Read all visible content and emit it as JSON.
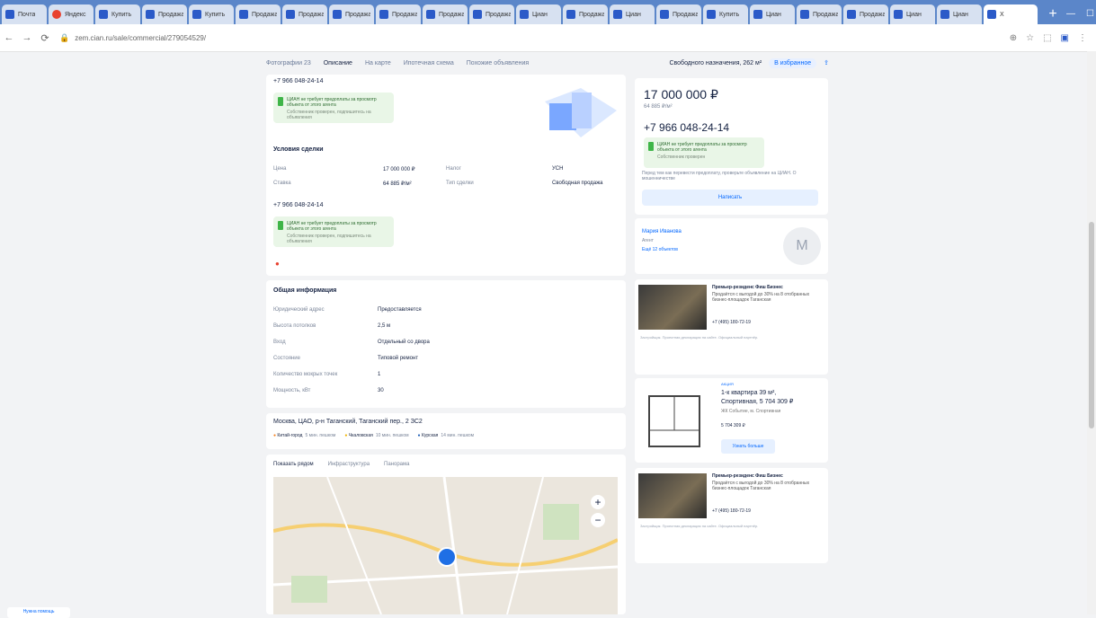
{
  "browser": {
    "tabs": [
      {
        "label": "Почта"
      },
      {
        "label": "Яндекс"
      },
      {
        "label": "Купить"
      },
      {
        "label": "Продажа"
      },
      {
        "label": "Купить"
      },
      {
        "label": "Продажа"
      },
      {
        "label": "Продажа"
      },
      {
        "label": "Продажа"
      },
      {
        "label": "Продажа"
      },
      {
        "label": "Продажа"
      },
      {
        "label": "Продажа"
      },
      {
        "label": "Циан"
      },
      {
        "label": "Продажа"
      },
      {
        "label": "Циан"
      },
      {
        "label": "Продажа"
      },
      {
        "label": "Купить"
      },
      {
        "label": "Циан"
      },
      {
        "label": "Продажа"
      },
      {
        "label": "Продажа"
      },
      {
        "label": "Циан"
      },
      {
        "label": "Циан"
      },
      {
        "label": "Х"
      }
    ],
    "new_tab": "+",
    "url": "zem.cian.ru/sale/commercial/279054529/"
  },
  "anchor_nav": {
    "items": [
      "Фотографии 23",
      "Описание",
      "На карте",
      "Ипотечная схема",
      "Похожие объявления"
    ],
    "right_text": "Свободного назначения, 262 м²",
    "right_btn": "В избранное"
  },
  "left": {
    "phone_top": "+7 966 048-24-14",
    "banner": {
      "title": "ЦИАН не требует предоплаты за просмотр объекта от этого агента",
      "sub": "Собственник проверен, подпишитесь на объявления"
    },
    "deal_title": "Условия сделки",
    "deal": [
      {
        "label": "Цена",
        "value": "17 000 000 ₽"
      },
      {
        "label": "Налог",
        "value": "УСН"
      },
      {
        "label": "Ставка",
        "value": "64 885 ₽/м²"
      },
      {
        "label": "Тип сделки",
        "value": "Свободная продажа"
      }
    ],
    "phone_mid": "+7 966 048-24-14",
    "info_title": "Общая информация",
    "info": [
      {
        "label": "Юридический адрес",
        "value": "Предоставляется"
      },
      {
        "label": "Высота потолков",
        "value": "2,5 м"
      },
      {
        "label": "Вход",
        "value": "Отдельный со двора"
      },
      {
        "label": "Состояние",
        "value": "Типовой ремонт"
      },
      {
        "label": "Количество мокрых точек",
        "value": "1"
      },
      {
        "label": "Мощность, кВт",
        "value": "30"
      }
    ],
    "address": "Москва, ЦАО, р-н Таганский, Таганский пер., 2 ЗС2",
    "metro": [
      {
        "name": "Китай-город",
        "time": "5 мин. пешком",
        "color": "#f58220"
      },
      {
        "name": "Чкаловская",
        "time": "10 мин. пешком",
        "color": "#f0b400"
      },
      {
        "name": "Курская",
        "time": "14 мин. пешком",
        "color": "#1a5bb5"
      }
    ],
    "map_tabs": [
      "Показать рядом",
      "Инфраструктура",
      "Панорама"
    ],
    "map_ctrl": {
      "plus": "+",
      "minus": "−"
    }
  },
  "right": {
    "price": "17 000 000 ₽",
    "price_sub": "64 885 ₽/м²",
    "phone": "+7 966 048-24-14",
    "banner_title": "ЦИАН не требует предоплаты за просмотр объекта от этого агента",
    "banner_sub": "Собственник проверен",
    "note": "Перед тем как перевести предоплату, проверьте объявление на ЦИАН. О мошенничестве",
    "write_btn": "Написать",
    "agent": {
      "name": "Мария Иванова",
      "role": "Агент",
      "link": "Ещё 12 объектов",
      "avatar": "M"
    },
    "ads": [
      {
        "title": "Премьер-резиденс Фиш Бизнес",
        "text": "Продаётся с выгодой до 30% на 8 отобранных бизнес-площадок Таганская",
        "phone": "+7 (495) 180-72-19",
        "fine": "Застройщик. Проектная декларация на сайте. Официальный партнёр."
      },
      {
        "tag": "АКЦИЯ",
        "title": "1-к квартира 39 м²,",
        "title2": "Спортивная, 5 704 309 ₽",
        "text": "ЖК Событие, м. Спортивная",
        "price": "5 704 309 ₽",
        "btn": "Узнать больше"
      },
      {
        "title": "Премьер-резиденс Фиш Бизнес",
        "text": "Продаётся с выгодой до 30% на 8 отобранных бизнес-площадок Таганская",
        "phone": "+7 (495) 180-72-19",
        "fine": "Застройщик. Проектная декларация на сайте. Официальный партнёр."
      }
    ]
  },
  "help": "Нужна помощь"
}
